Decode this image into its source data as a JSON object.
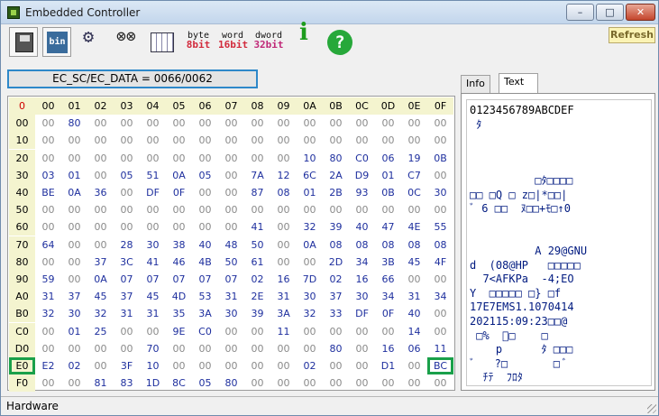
{
  "window": {
    "title": "Embedded Controller"
  },
  "toolbar": {
    "byte_top": "byte",
    "byte_bits": "8bit",
    "word_top": "word",
    "word_bits": "16bit",
    "dword_top": "dword",
    "dword_bits": "32bit",
    "bin_label": "bin",
    "refresh_label": "Refresh"
  },
  "ec_port": "EC_SC/EC_DATA = 0066/0062",
  "tabs": [
    "Info",
    "Text"
  ],
  "active_tab": "Text",
  "grid": {
    "corner": "0",
    "columns": [
      "00",
      "01",
      "02",
      "03",
      "04",
      "05",
      "06",
      "07",
      "08",
      "09",
      "0A",
      "0B",
      "0C",
      "0D",
      "0E",
      "0F"
    ],
    "rows": [
      "00",
      "10",
      "20",
      "30",
      "40",
      "50",
      "60",
      "70",
      "80",
      "90",
      "A0",
      "B0",
      "C0",
      "D0",
      "E0",
      "F0"
    ],
    "values": [
      [
        "00",
        "80",
        "00",
        "00",
        "00",
        "00",
        "00",
        "00",
        "00",
        "00",
        "00",
        "00",
        "00",
        "00",
        "00",
        "00"
      ],
      [
        "00",
        "00",
        "00",
        "00",
        "00",
        "00",
        "00",
        "00",
        "00",
        "00",
        "00",
        "00",
        "00",
        "00",
        "00",
        "00"
      ],
      [
        "00",
        "00",
        "00",
        "00",
        "00",
        "00",
        "00",
        "00",
        "00",
        "00",
        "10",
        "80",
        "C0",
        "06",
        "19",
        "0B"
      ],
      [
        "03",
        "01",
        "00",
        "05",
        "51",
        "0A",
        "05",
        "00",
        "7A",
        "12",
        "6C",
        "2A",
        "D9",
        "01",
        "C7",
        "00"
      ],
      [
        "BE",
        "0A",
        "36",
        "00",
        "DF",
        "0F",
        "00",
        "00",
        "87",
        "08",
        "01",
        "2B",
        "93",
        "0B",
        "0C",
        "30"
      ],
      [
        "00",
        "00",
        "00",
        "00",
        "00",
        "00",
        "00",
        "00",
        "00",
        "00",
        "00",
        "00",
        "00",
        "00",
        "00",
        "00"
      ],
      [
        "00",
        "00",
        "00",
        "00",
        "00",
        "00",
        "00",
        "00",
        "41",
        "00",
        "32",
        "39",
        "40",
        "47",
        "4E",
        "55"
      ],
      [
        "64",
        "00",
        "00",
        "28",
        "30",
        "38",
        "40",
        "48",
        "50",
        "00",
        "0A",
        "08",
        "08",
        "08",
        "08",
        "08"
      ],
      [
        "00",
        "00",
        "37",
        "3C",
        "41",
        "46",
        "4B",
        "50",
        "61",
        "00",
        "00",
        "2D",
        "34",
        "3B",
        "45",
        "4F"
      ],
      [
        "59",
        "00",
        "0A",
        "07",
        "07",
        "07",
        "07",
        "07",
        "02",
        "16",
        "7D",
        "02",
        "16",
        "66",
        "00",
        "00"
      ],
      [
        "31",
        "37",
        "45",
        "37",
        "45",
        "4D",
        "53",
        "31",
        "2E",
        "31",
        "30",
        "37",
        "30",
        "34",
        "31",
        "34"
      ],
      [
        "32",
        "30",
        "32",
        "31",
        "31",
        "35",
        "3A",
        "30",
        "39",
        "3A",
        "32",
        "33",
        "DF",
        "0F",
        "40",
        "00"
      ],
      [
        "00",
        "01",
        "25",
        "00",
        "00",
        "9E",
        "C0",
        "00",
        "00",
        "11",
        "00",
        "00",
        "00",
        "00",
        "14",
        "00"
      ],
      [
        "00",
        "00",
        "00",
        "00",
        "70",
        "00",
        "00",
        "00",
        "00",
        "00",
        "00",
        "80",
        "00",
        "16",
        "06",
        "11"
      ],
      [
        "E2",
        "02",
        "00",
        "3F",
        "10",
        "00",
        "00",
        "00",
        "00",
        "00",
        "02",
        "00",
        "00",
        "D1",
        "00",
        "BC"
      ],
      [
        "00",
        "00",
        "81",
        "83",
        "1D",
        "8C",
        "05",
        "80",
        "00",
        "00",
        "00",
        "00",
        "00",
        "00",
        "00",
        "00"
      ]
    ],
    "highlighted": [
      "E0",
      "BC"
    ]
  },
  "text_view": {
    "lines": [
      "0123456789ABCDEF",
      " ﾀ",
      "",
      "",
      "",
      "          □ﾀ□□□□",
      "□□ □Q □ z□|*□□|",
      "ﾞ 6 □□  ﾇ□□+ﾓ□↑0",
      "",
      "",
      "          A 29@GNU",
      "d  (08@HP   □□□□□",
      "  7<AFKPa  -4;EO",
      "Y  □□□□□ □} □f",
      "17E7EMS1.1070414",
      "202115:09:23□□@",
      " □%  ﾞ□    □",
      "    p      ﾀ □□□",
      "ﾞ   ?□       □ ﾞ",
      "  ﾁﾃ  ﾌﾛﾀ"
    ]
  },
  "status": {
    "text": "Hardware"
  },
  "colors": {
    "accent_border": "#2e88c9",
    "highlight": "#1aa04a",
    "header_bg": "#f4f4cf",
    "value": "#1e2f9e"
  }
}
